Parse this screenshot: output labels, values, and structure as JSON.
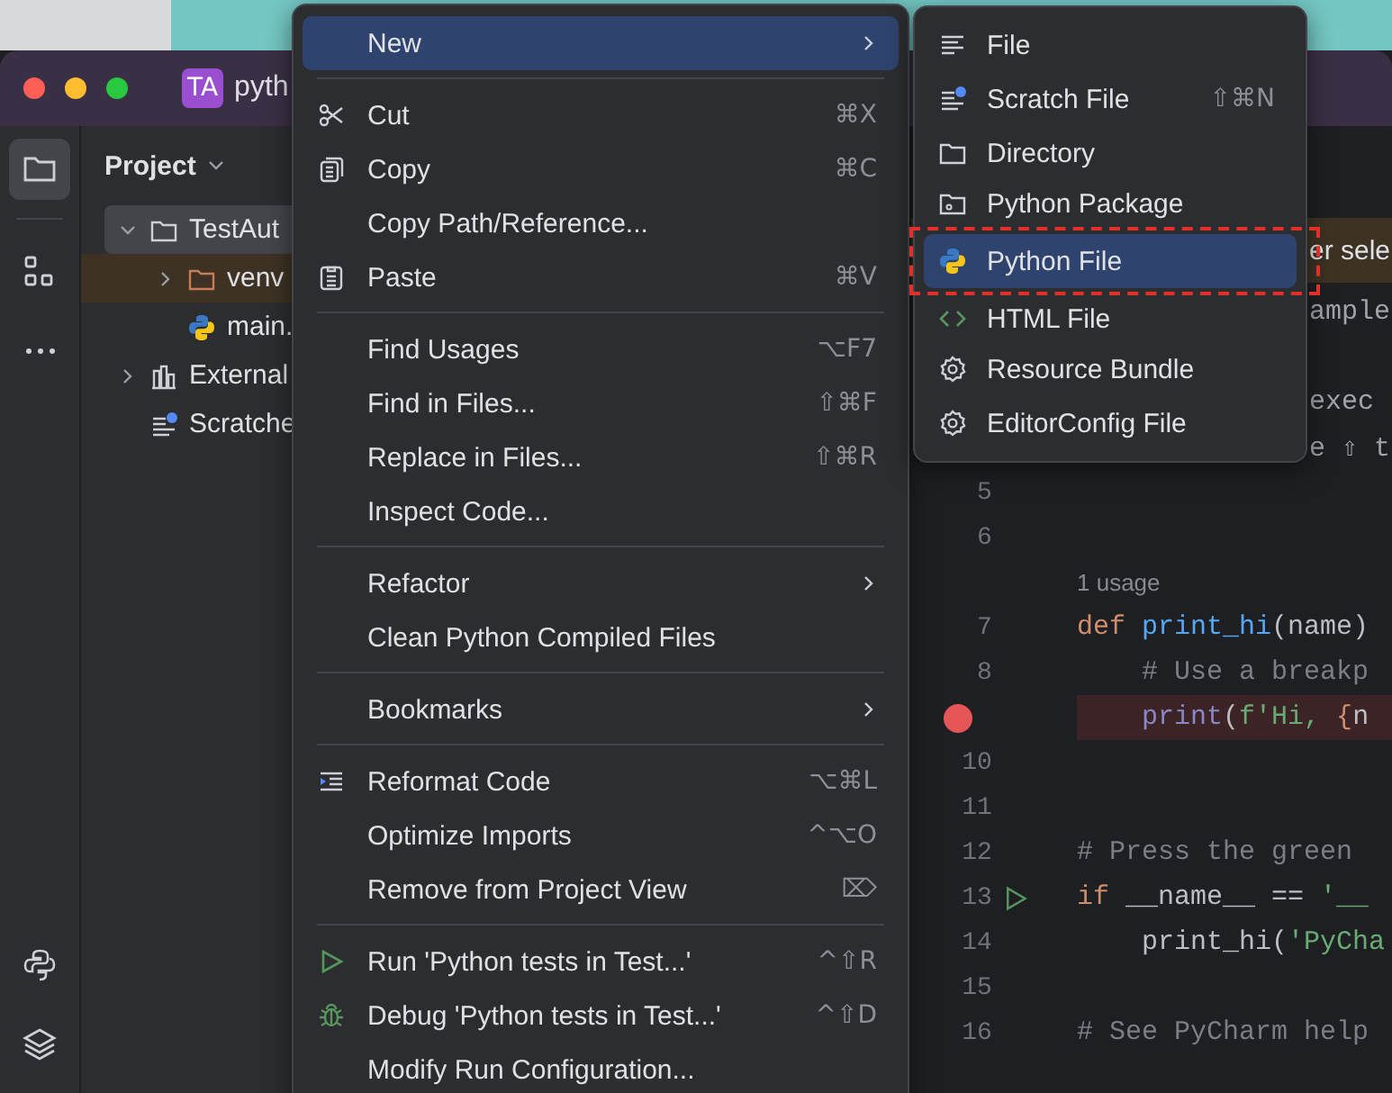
{
  "window": {
    "badge": "TA",
    "title": "pyth"
  },
  "toolbar": {
    "items": [
      {
        "selected": true
      },
      {
        "selected": false
      },
      {
        "selected": false
      },
      {
        "selected": false
      },
      {
        "selected": false
      }
    ]
  },
  "project": {
    "title": "Project",
    "tree": [
      {
        "kind": "folder",
        "name": "TestAut",
        "expanded": true,
        "selected": true,
        "excluded": false,
        "children": [
          {
            "kind": "folder",
            "name": "venv",
            "expanded": false,
            "selected": false,
            "excluded": true
          },
          {
            "kind": "python",
            "name": "main.",
            "selected": false,
            "excluded": false
          }
        ]
      },
      {
        "kind": "library",
        "name": "External",
        "expanded": false,
        "selected": false,
        "excluded": false
      },
      {
        "kind": "scratches",
        "name": "Scratche",
        "selected": false,
        "excluded": false
      }
    ]
  },
  "editor": {
    "banner": "er sele",
    "lines": [
      {
        "kind": "fragment",
        "text": "ample"
      },
      {
        "kind": "blank"
      },
      {
        "kind": "fragment",
        "text": "exec"
      },
      {
        "kind": "fragment",
        "text": "e ⇧ t"
      },
      {
        "kind": "code",
        "number": "5",
        "breakpoint": false,
        "run_marker": false
      },
      {
        "kind": "code",
        "number": "6",
        "breakpoint": false,
        "run_marker": false
      },
      {
        "kind": "usage",
        "text": "1 usage"
      },
      {
        "kind": "code",
        "number": "7",
        "breakpoint": false,
        "run_marker": false,
        "indented": false,
        "tokens": [
          {
            "kind": "keyword",
            "text": "def "
          },
          {
            "kind": "function",
            "text": "print_hi"
          },
          {
            "kind": "plain",
            "text": "(name)"
          }
        ]
      },
      {
        "kind": "code",
        "number": "8",
        "breakpoint": false,
        "run_marker": false,
        "indented": true,
        "tokens": [
          {
            "kind": "comment",
            "text": "# Use a breakp"
          }
        ]
      },
      {
        "kind": "code",
        "breakpoint": true,
        "run_marker": false,
        "indented": true,
        "tokens": [
          {
            "kind": "builtin",
            "text": "print"
          },
          {
            "kind": "plain",
            "text": "("
          },
          {
            "kind": "string",
            "text": "f'Hi, "
          },
          {
            "kind": "keyword",
            "text": "{"
          },
          {
            "kind": "plain",
            "text": "n"
          }
        ]
      },
      {
        "kind": "code",
        "number": "10",
        "breakpoint": false,
        "run_marker": false
      },
      {
        "kind": "code",
        "number": "11",
        "breakpoint": false,
        "run_marker": false
      },
      {
        "kind": "code",
        "number": "12",
        "breakpoint": false,
        "run_marker": false,
        "indented": false,
        "tokens": [
          {
            "kind": "comment",
            "text": "# Press the green"
          }
        ]
      },
      {
        "kind": "code",
        "number": "13",
        "breakpoint": false,
        "run_marker": true,
        "indented": false,
        "tokens": [
          {
            "kind": "keyword",
            "text": "if"
          },
          {
            "kind": "plain",
            "text": " __name__ == "
          },
          {
            "kind": "string",
            "text": "'__"
          }
        ]
      },
      {
        "kind": "code",
        "number": "14",
        "breakpoint": false,
        "run_marker": false,
        "indented": true,
        "tokens": [
          {
            "kind": "plain",
            "text": "print_hi("
          },
          {
            "kind": "string",
            "text": "'PyCha"
          }
        ]
      },
      {
        "kind": "code",
        "number": "15",
        "breakpoint": false,
        "run_marker": false
      },
      {
        "kind": "code",
        "number": "16",
        "breakpoint": false,
        "run_marker": false,
        "indented": false,
        "tokens": [
          {
            "kind": "comment",
            "text": "# See PyCharm help"
          }
        ]
      }
    ]
  },
  "context_menu": {
    "items": [
      {
        "kind": "item",
        "label": "New",
        "selected": true,
        "has_submenu": true
      },
      {
        "kind": "separator"
      },
      {
        "kind": "item",
        "label": "Cut",
        "shortcut": "⌘X",
        "selected": false,
        "has_submenu": false
      },
      {
        "kind": "item",
        "label": "Copy",
        "shortcut": "⌘C",
        "selected": false,
        "has_submenu": false
      },
      {
        "kind": "item",
        "label": "Copy Path/Reference...",
        "selected": false,
        "has_submenu": false
      },
      {
        "kind": "item",
        "label": "Paste",
        "shortcut": "⌘V",
        "selected": false,
        "has_submenu": false
      },
      {
        "kind": "separator"
      },
      {
        "kind": "item",
        "label": "Find Usages",
        "shortcut": "⌥F7",
        "selected": false,
        "has_submenu": false
      },
      {
        "kind": "item",
        "label": "Find in Files...",
        "shortcut": "⇧⌘F",
        "selected": false,
        "has_submenu": false
      },
      {
        "kind": "item",
        "label": "Replace in Files...",
        "shortcut": "⇧⌘R",
        "selected": false,
        "has_submenu": false
      },
      {
        "kind": "item",
        "label": "Inspect Code...",
        "selected": false,
        "has_submenu": false
      },
      {
        "kind": "separator"
      },
      {
        "kind": "item",
        "label": "Refactor",
        "selected": false,
        "has_submenu": true
      },
      {
        "kind": "item",
        "label": "Clean Python Compiled Files",
        "selected": false,
        "has_submenu": false
      },
      {
        "kind": "separator"
      },
      {
        "kind": "item",
        "label": "Bookmarks",
        "selected": false,
        "has_submenu": true
      },
      {
        "kind": "separator"
      },
      {
        "kind": "item",
        "label": "Reformat Code",
        "shortcut": "⌥⌘L",
        "selected": false,
        "has_submenu": false
      },
      {
        "kind": "item",
        "label": "Optimize Imports",
        "shortcut": "^⌥O",
        "selected": false,
        "has_submenu": false
      },
      {
        "kind": "item",
        "label": "Remove from Project View",
        "shortcut": "⌦",
        "selected": false,
        "has_submenu": false
      },
      {
        "kind": "separator"
      },
      {
        "kind": "item",
        "label": "Run 'Python tests in Test...'",
        "shortcut": "^⇧R",
        "selected": false,
        "has_submenu": false
      },
      {
        "kind": "item",
        "label": "Debug 'Python tests in Test...'",
        "shortcut": "^⇧D",
        "selected": false,
        "has_submenu": false
      },
      {
        "kind": "item",
        "label": "Modify Run Configuration...",
        "selected": false,
        "has_submenu": false
      }
    ]
  },
  "submenu": {
    "items": [
      {
        "label": "File",
        "selected": false,
        "marked": false
      },
      {
        "label": "Scratch File",
        "shortcut": "⇧⌘N",
        "selected": false,
        "marked": false
      },
      {
        "label": "Directory",
        "selected": false,
        "marked": false
      },
      {
        "label": "Python Package",
        "selected": false,
        "marked": false
      },
      {
        "label": "Python File",
        "selected": true,
        "marked": true
      },
      {
        "label": "HTML File",
        "selected": false,
        "marked": false
      },
      {
        "label": "Resource Bundle",
        "selected": false,
        "marked": false
      },
      {
        "label": "EditorConfig File",
        "selected": false,
        "marked": false
      }
    ]
  }
}
